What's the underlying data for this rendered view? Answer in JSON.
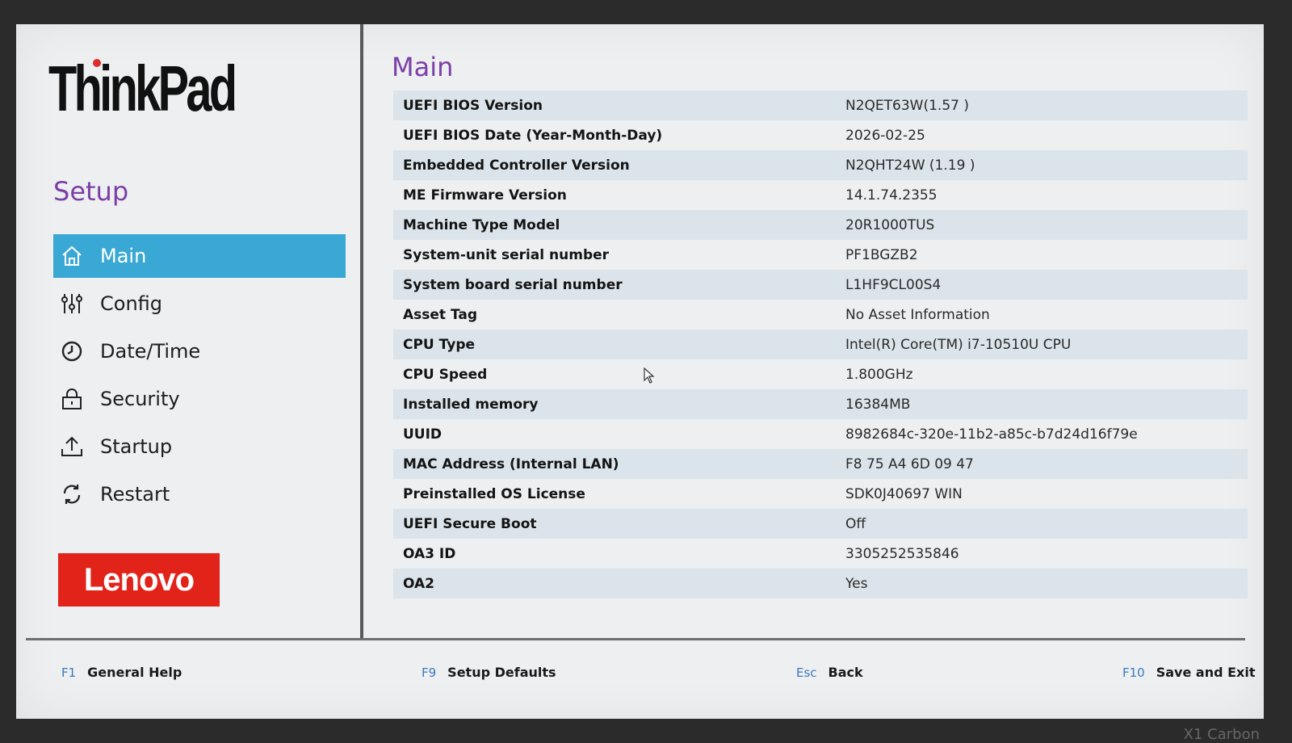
{
  "brand": {
    "logo_text": "ThinkPad"
  },
  "sidebar": {
    "setup_label": "Setup",
    "items": [
      {
        "label": "Main",
        "icon": "home-icon",
        "active": true
      },
      {
        "label": "Config",
        "icon": "sliders-icon"
      },
      {
        "label": "Date/Time",
        "icon": "clock-icon"
      },
      {
        "label": "Security",
        "icon": "lock-icon"
      },
      {
        "label": "Startup",
        "icon": "upload-icon"
      },
      {
        "label": "Restart",
        "icon": "restart-icon"
      }
    ],
    "lenovo_logo": "Lenovo"
  },
  "main": {
    "title": "Main",
    "rows": [
      {
        "label": "UEFI BIOS Version",
        "value": "N2QET63W(1.57 )"
      },
      {
        "label": "UEFI BIOS Date (Year-Month-Day)",
        "value": "2026-02-25"
      },
      {
        "label": "Embedded Controller Version",
        "value": "N2QHT24W (1.19 )"
      },
      {
        "label": "ME Firmware Version",
        "value": "14.1.74.2355"
      },
      {
        "label": "Machine Type Model",
        "value": "20R1000TUS"
      },
      {
        "label": "System-unit serial number",
        "value": "PF1BGZB2"
      },
      {
        "label": "System board serial number",
        "value": "L1HF9CL00S4"
      },
      {
        "label": "Asset Tag",
        "value": "No Asset Information"
      },
      {
        "label": "CPU Type",
        "value": "Intel(R) Core(TM) i7-10510U CPU"
      },
      {
        "label": "CPU Speed",
        "value": "1.800GHz"
      },
      {
        "label": "Installed memory",
        "value": "16384MB"
      },
      {
        "label": "UUID",
        "value": "8982684c-320e-11b2-a85c-b7d24d16f79e"
      },
      {
        "label": "MAC Address (Internal LAN)",
        "value": "F8 75 A4 6D 09 47"
      },
      {
        "label": "Preinstalled OS License",
        "value": "SDK0J40697 WIN"
      },
      {
        "label": "UEFI Secure Boot",
        "value": "Off"
      },
      {
        "label": "OA3 ID",
        "value": "3305252535846"
      },
      {
        "label": "OA2",
        "value": "Yes"
      }
    ]
  },
  "footer": {
    "keys": [
      {
        "key": "F1",
        "label": "General Help"
      },
      {
        "key": "F9",
        "label": "Setup Defaults"
      },
      {
        "key": "Esc",
        "label": "Back"
      },
      {
        "key": "F10",
        "label": "Save and Exit"
      }
    ]
  },
  "bezel": {
    "model": "X1 Carbon"
  },
  "colors": {
    "accent": "#3aa8d4",
    "title": "#7c3fa8",
    "lenovo_red": "#e2231a",
    "fkey": "#3a7bbf"
  }
}
